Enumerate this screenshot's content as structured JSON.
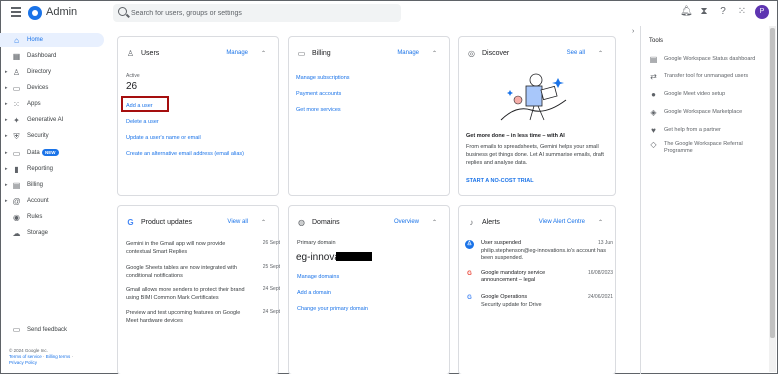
{
  "app": {
    "title": "Admin"
  },
  "search": {
    "placeholder": "Search for users, groups or settings"
  },
  "topbar": {
    "avatar_letter": "P"
  },
  "sidebar": {
    "items": [
      {
        "label": "Home",
        "icon": "home-icon",
        "glyph": "⌂",
        "arrow": ""
      },
      {
        "label": "Dashboard",
        "icon": "dashboard-icon",
        "glyph": "▦",
        "arrow": ""
      },
      {
        "label": "Directory",
        "icon": "person-icon",
        "glyph": "♙",
        "arrow": "▸"
      },
      {
        "label": "Devices",
        "icon": "devices-icon",
        "glyph": "▭",
        "arrow": "▸"
      },
      {
        "label": "Apps",
        "icon": "apps-grid-icon",
        "glyph": "⁙",
        "arrow": "▸"
      },
      {
        "label": "Generative AI",
        "icon": "sparkle-icon",
        "glyph": "✦",
        "arrow": "▸"
      },
      {
        "label": "Security",
        "icon": "shield-icon",
        "glyph": "⛨",
        "arrow": "▸"
      },
      {
        "label": "Data",
        "icon": "data-icon",
        "glyph": "▭",
        "arrow": "▸"
      },
      {
        "label": "Reporting",
        "icon": "bar-chart-icon",
        "glyph": "▮",
        "arrow": "▸"
      },
      {
        "label": "Billing",
        "icon": "billing-icon",
        "glyph": "▤",
        "arrow": "▸"
      },
      {
        "label": "Account",
        "icon": "at-icon",
        "glyph": "@",
        "arrow": "▸"
      },
      {
        "label": "Rules",
        "icon": "rules-icon",
        "glyph": "◉",
        "arrow": ""
      },
      {
        "label": "Storage",
        "icon": "cloud-icon",
        "glyph": "☁",
        "arrow": ""
      }
    ],
    "data_badge": "NEW",
    "feedback": "Send feedback",
    "copyright": "© 2024 Google Inc.",
    "terms": "Terms of service",
    "billing_terms": "Billing terms",
    "privacy": "Privacy Policy"
  },
  "users_card": {
    "title": "Users",
    "action": "Manage",
    "active_label": "Active",
    "active_count": "26",
    "links": [
      "Add a user",
      "Delete a user",
      "Update a user's name or email",
      "Create an alternative email address (email alias)"
    ]
  },
  "billing_card": {
    "title": "Billing",
    "action": "Manage",
    "links": [
      "Manage subscriptions",
      "Payment accounts",
      "Get more services"
    ]
  },
  "discover_card": {
    "title": "Discover",
    "action": "See all",
    "headline": "Get more done – in less time – with AI",
    "body": "From emails to spreadsheets, Gemini helps your small business get things done. Let AI summarise emails, draft replies and analyse data.",
    "cta": "START A NO-COST TRIAL"
  },
  "product_updates_card": {
    "title": "Product updates",
    "action": "View all",
    "items": [
      {
        "text": "Gemini in the Gmail app will now provide contextual Smart Replies",
        "date": "26 Sept"
      },
      {
        "text": "Google Sheets tables are now integrated with conditional notifications",
        "date": "25 Sept"
      },
      {
        "text": "Gmail allows more senders to protect their brand using BIMI Common Mark Certificates",
        "date": "24 Sept"
      },
      {
        "text": "Preview and test upcoming features on Google Meet hardware devices",
        "date": "24 Sept"
      }
    ]
  },
  "domains_card": {
    "title": "Domains",
    "action": "Overview",
    "primary_label": "Primary domain",
    "primary_domain": "eg-innova",
    "links": [
      "Manage domains",
      "Add a domain",
      "Change your primary domain"
    ]
  },
  "alerts_card": {
    "title": "Alerts",
    "action": "View Alert Centre",
    "items": [
      {
        "title": "User suspended",
        "sub": "philip.stephenson@eg-innovations.io's account has been suspended.",
        "date": "13 Jun"
      },
      {
        "title": "Google mandatory service announcement – legal",
        "sub": "",
        "date": "16/08/2023"
      },
      {
        "title": "Google Operations",
        "sub": "Security update for Drive",
        "date": "24/06/2021"
      }
    ]
  },
  "tools_panel": {
    "title": "Tools",
    "items": [
      {
        "label": "Google Workspace Status dashboard",
        "icon": "status-dashboard-icon",
        "glyph": "▤"
      },
      {
        "label": "Transfer tool for unmanaged users",
        "icon": "transfer-icon",
        "glyph": "⇄"
      },
      {
        "label": "Google Meet video setup",
        "icon": "meet-icon",
        "glyph": "●"
      },
      {
        "label": "Google Workspace Marketplace",
        "icon": "marketplace-icon",
        "glyph": "◈"
      },
      {
        "label": "Get help from a partner",
        "icon": "partner-icon",
        "glyph": "♥"
      },
      {
        "label": "The Google Workspace Referral Programme",
        "icon": "referral-icon",
        "glyph": "◇"
      }
    ]
  },
  "colors": {
    "accent": "#1a73e8",
    "highlight_box": "#a50e0e",
    "avatar": "#5e35b1"
  }
}
